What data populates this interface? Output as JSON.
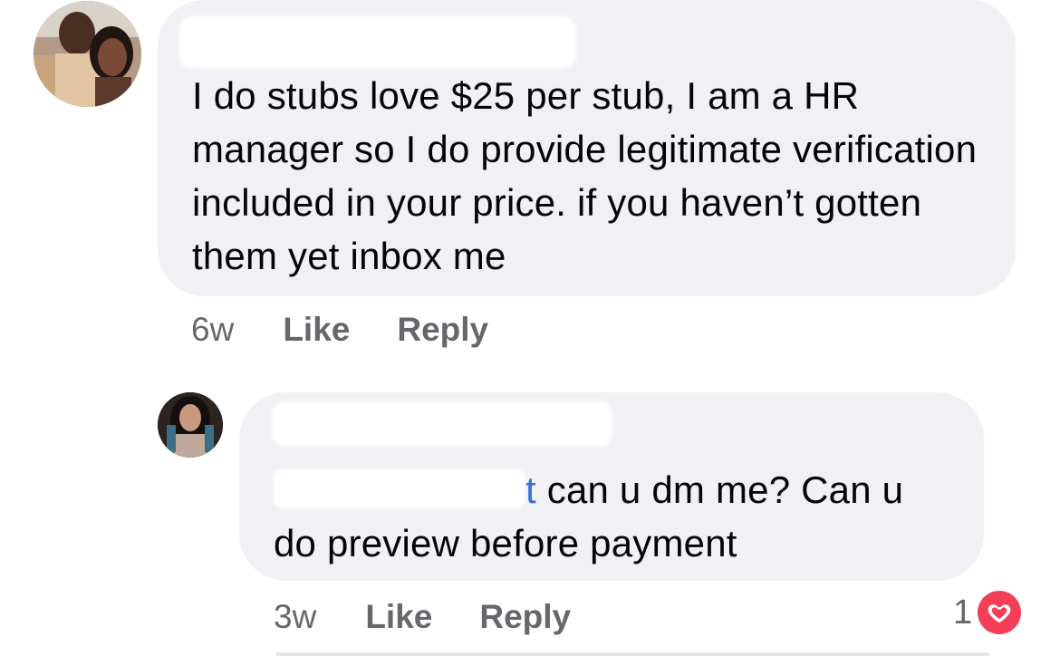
{
  "comments": [
    {
      "avatar_icon": "couple-photo-avatar",
      "author": "",
      "text": "I do stubs love $25 per stub, I am a HR manager so I do provide legitimate verification included in your price.  if you haven’t gotten them yet inbox me",
      "timestamp": "6w",
      "like_label": "Like",
      "reply_label": "Reply"
    },
    {
      "avatar_icon": "woman-photo-avatar",
      "author": "",
      "mention_visible_tail": "t",
      "text": " can u dm me? Can u do preview before payment",
      "timestamp": "3w",
      "like_label": "Like",
      "reply_label": "Reply",
      "reaction": {
        "count": "1",
        "icon": "heart-icon",
        "color": "#f33e58"
      }
    }
  ],
  "colors": {
    "bubble": "#f0f0f5",
    "meta_text": "#65676b",
    "mention": "#3b6fd3"
  }
}
